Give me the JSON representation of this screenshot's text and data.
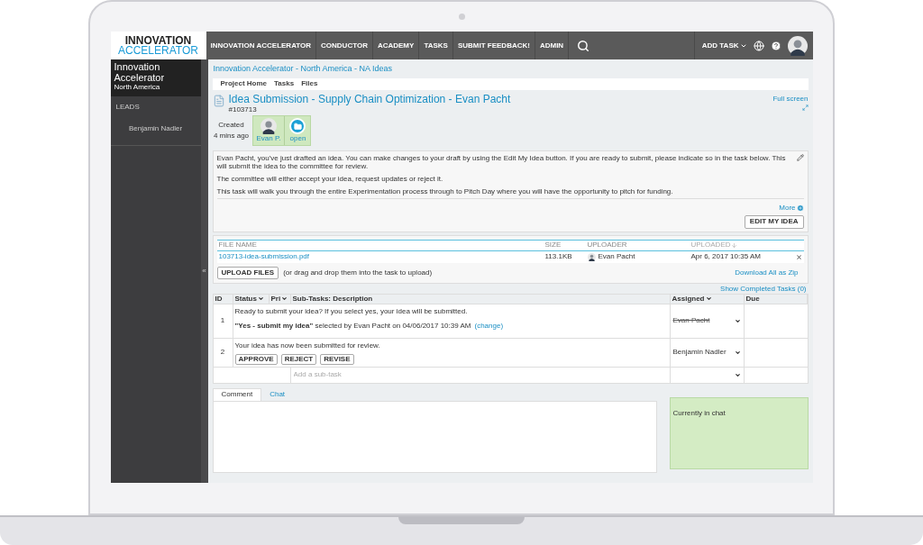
{
  "logo": {
    "line1": "INNOVATION",
    "line2": "ACCELERATOR"
  },
  "nav": {
    "items": [
      {
        "label": "INNOVATION ACCELERATOR"
      },
      {
        "label": "CONDUCTOR"
      },
      {
        "label": "ACADEMY"
      },
      {
        "label": "TASKS"
      },
      {
        "label": "SUBMIT FEEDBACK!"
      },
      {
        "label": "ADMIN"
      }
    ],
    "add_task": "ADD TASK"
  },
  "sidebar": {
    "title": "Innovation Accelerator",
    "subtitle": "North America",
    "collapse": "«",
    "section": "LEADS",
    "leads": [
      "Benjamin Nadler"
    ]
  },
  "breadcrumb": "Innovation Accelerator - North America - NA Ideas",
  "tabs": [
    {
      "label": "Project Home"
    },
    {
      "label": "Tasks"
    },
    {
      "label": "Files"
    }
  ],
  "task": {
    "title": "Idea Submission - Supply Chain Optimization - Evan Pacht",
    "id": "#103713",
    "full_screen": "Full screen",
    "created_label": "Created",
    "created_ago": "4 mins ago",
    "owner": "Evan P.",
    "status": "open"
  },
  "description": {
    "paragraphs": [
      "Evan Pacht, you've just drafted an idea. You can make changes to your draft by using the Edit My Idea button. If you are ready to submit, please indicate so in the task below. This will submit the idea to the committee for review.",
      "The committee will either accept your idea, request updates or reject it.",
      "This task will walk you through the entire Experimentation process through to Pitch Day where you will have the opportunity to pitch for funding."
    ],
    "more": "More",
    "edit_button": "EDIT MY IDEA"
  },
  "files": {
    "columns": [
      {
        "label": "FILE NAME",
        "sorted": false
      },
      {
        "label": "SIZE",
        "sorted": false
      },
      {
        "label": "UPLOADER",
        "sorted": false
      },
      {
        "label": "UPLOADED",
        "sorted": true
      }
    ],
    "rows": [
      {
        "name": "103713-idea-submission.pdf",
        "size": "113.1KB",
        "uploader": "Evan Pacht",
        "uploaded": "Apr 6, 2017 10:35 AM"
      }
    ],
    "upload_button": "UPLOAD FILES",
    "upload_hint": "(or drag and drop them into the task to upload)",
    "download_all": "Download All as Zip"
  },
  "show_completed": "Show Completed Tasks (0)",
  "subtasks": {
    "columns": [
      {
        "label": "ID",
        "sortable": false
      },
      {
        "label": "Status",
        "sortable": true
      },
      {
        "label": "Pri",
        "sortable": true
      },
      {
        "label": "Sub-Tasks: Description",
        "sortable": false
      },
      {
        "label": "Assigned",
        "sortable": true
      },
      {
        "label": "Due",
        "sortable": false
      }
    ],
    "rows": [
      {
        "id": "1",
        "text": "Ready to submit your idea? If you select yes, your idea will be submitted.",
        "selection": "**\"Yes - submit my idea\"** selected by Evan Pacht on 04/06/2017 10:39 AM",
        "change_link": "(change)",
        "assigned": "Evan Pacht",
        "struck": true
      },
      {
        "id": "2",
        "text": "Your idea has now been submitted for review.",
        "buttons": [
          "APPROVE",
          "REJECT",
          "REVISE"
        ],
        "assigned": "Benjamin Nadler",
        "struck": false
      }
    ],
    "add_placeholder": "Add a sub-task"
  },
  "comment_tabs": [
    {
      "label": "Comment",
      "selected": true
    },
    {
      "label": "Chat",
      "selected": false
    }
  ],
  "chat": {
    "title": "Currently in chat"
  }
}
